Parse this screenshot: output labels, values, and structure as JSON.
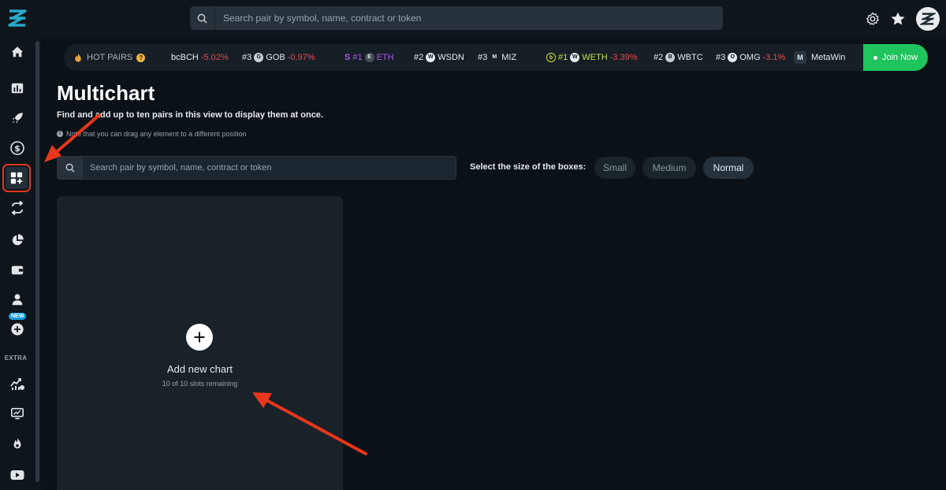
{
  "header": {
    "search_placeholder": "Search pair by symbol, name, contract or token",
    "icons": [
      "logo-icon",
      "search-icon",
      "gear-icon",
      "star-icon",
      "avatar"
    ]
  },
  "sidebar": {
    "new_badge": "NEW",
    "extra_label": "EXTRA",
    "items": [
      "home-icon",
      "dashboard-icon",
      "rocket-icon",
      "dollar-icon",
      "multichart-icon",
      "swap-icon",
      "pie-chart-icon",
      "wallet-icon",
      "user-icon",
      "plus-circle-icon",
      "trending-icon",
      "monitor-icon",
      "fire-icon",
      "youtube-icon"
    ]
  },
  "ticker": {
    "hot_label": "HOT PAIRS",
    "items": [
      {
        "rank": "",
        "symbol": "bcBCH",
        "change": "-5.02%"
      },
      {
        "rank": "#3",
        "symbol": "GOB",
        "change": "-0.97%"
      },
      {
        "rank": "#1",
        "symbol": "ETH",
        "change": ""
      },
      {
        "rank": "#2",
        "symbol": "WSDN",
        "change": ""
      },
      {
        "rank": "#3",
        "symbol": "MIZ",
        "change": ""
      },
      {
        "rank": "#1",
        "symbol": "WETH",
        "change": "-3.39%"
      },
      {
        "rank": "#2",
        "symbol": "WBTC",
        "change": ""
      },
      {
        "rank": "#3",
        "symbol": "OMG",
        "change": "-3.1%"
      }
    ],
    "sponsor": "MetaWin",
    "join_label": "Join Now"
  },
  "main": {
    "title": "Multichart",
    "description": "Find and add up to ten pairs in this view to display them at once.",
    "note": "Note that you can drag any element to a different position",
    "search_placeholder": "Search pair by symbol, name, contract or token",
    "size_label": "Select the size of the boxes:",
    "sizes": [
      "Small",
      "Medium",
      "Normal"
    ],
    "selected_size": "Normal"
  },
  "slot": {
    "title": "Add new chart",
    "subtitle": "10 of 10 slots remaining"
  },
  "colors": {
    "background": "#0b1217",
    "accent_green": "#20c45d",
    "negative": "#e5484d",
    "annotation_red": "#e8361d"
  }
}
